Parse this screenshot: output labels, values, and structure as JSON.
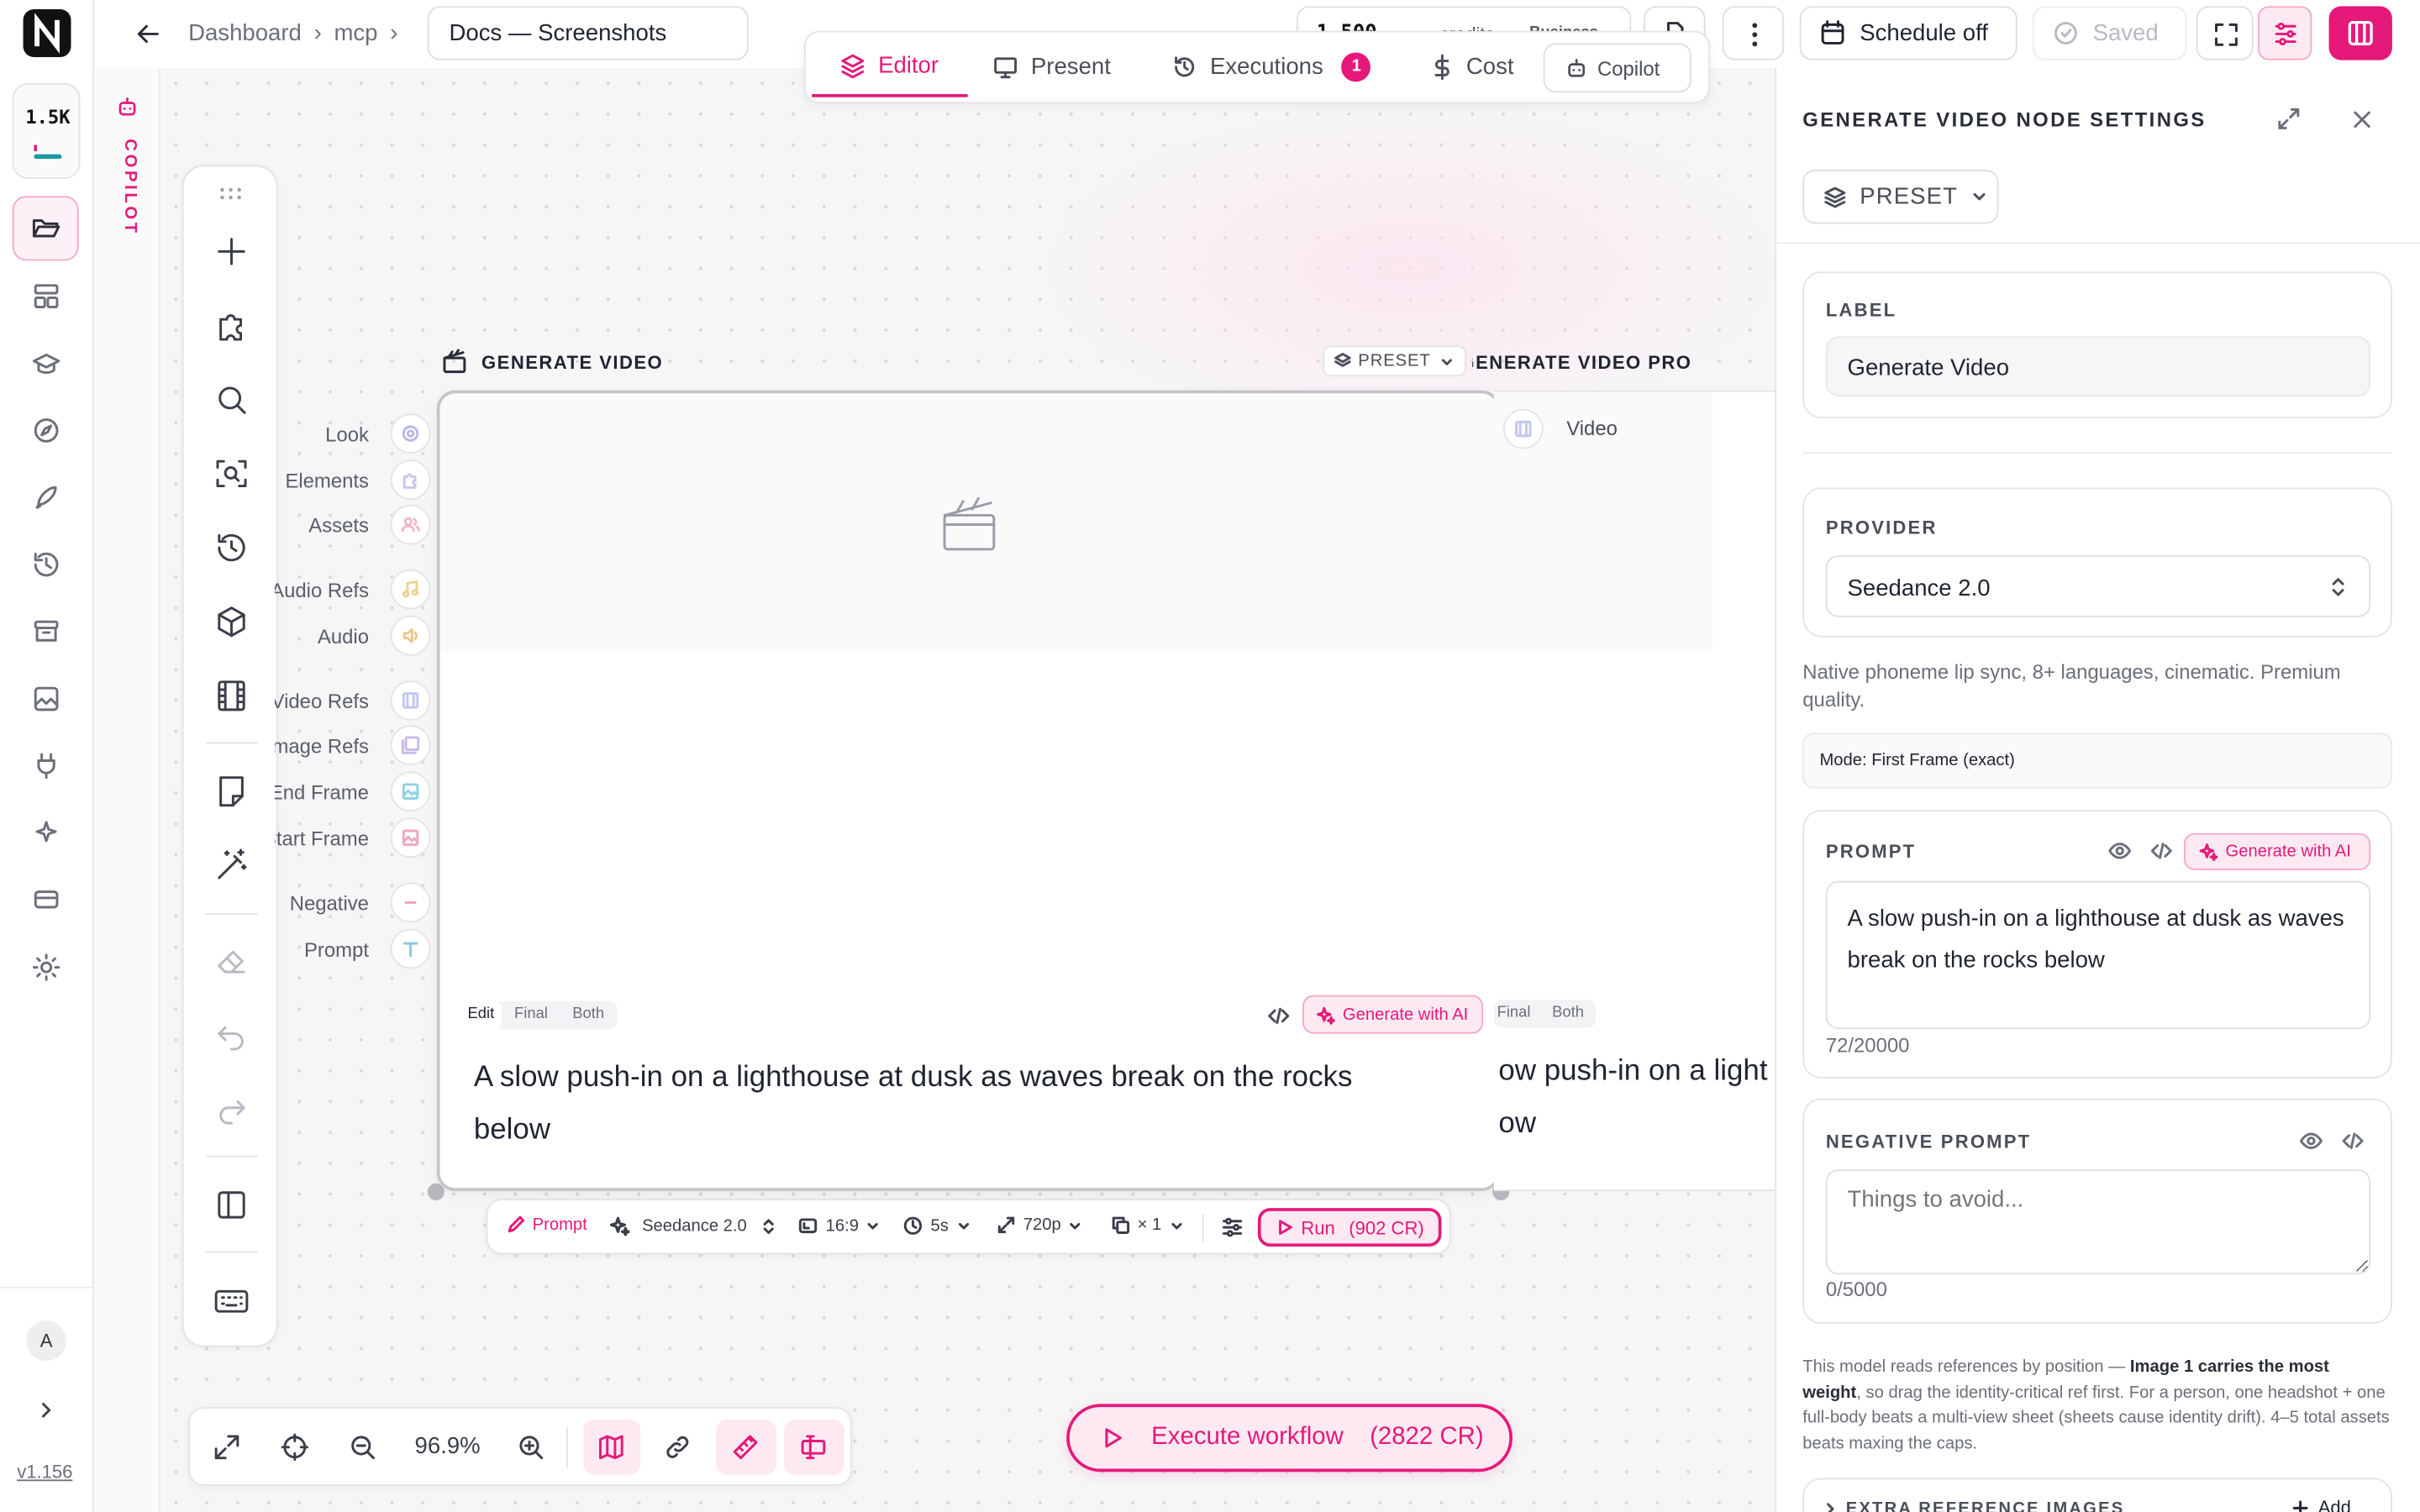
{
  "breadcrumb": {
    "items": [
      "Dashboard",
      "mcp"
    ],
    "doc_title": "Docs — Screenshots"
  },
  "credits": {
    "amount": "1,500",
    "unit": "credits",
    "plan": "Business"
  },
  "header": {
    "schedule_label": "Schedule off",
    "saved_label": "Saved"
  },
  "tabs": [
    {
      "label": "Editor"
    },
    {
      "label": "Present"
    },
    {
      "label": "Executions",
      "badge": "1"
    },
    {
      "label": "Cost"
    },
    {
      "label": "Copilot"
    }
  ],
  "sidebar": {
    "usage": "1.5K",
    "avatar": "A",
    "version": "v1.156",
    "copilot_label": "COPILOT"
  },
  "node": {
    "title": "GENERATE VIDEO",
    "ports": [
      "Look",
      "Elements",
      "Assets",
      "Audio Refs",
      "Audio",
      "Video Refs",
      "Image Refs",
      "End Frame",
      "Start Frame",
      "Negative",
      "Prompt"
    ],
    "view_modes": [
      "Edit",
      "Final",
      "Both"
    ],
    "gen_ai": "Generate with AI",
    "prompt": "A slow push-in on a lighthouse at dusk as waves break on the rocks below"
  },
  "node2": {
    "preset": "PRESET",
    "title": "GENERATE VIDEO PRO",
    "port": "Video",
    "view_modes": [
      "Final",
      "Both"
    ],
    "prompt_fragment": "ow push-in on a light",
    "prompt_fragment2": "ow"
  },
  "node_toolbar": {
    "prompt": "Prompt",
    "provider": "Seedance 2.0",
    "aspect": "16:9",
    "duration": "5s",
    "resolution": "720p",
    "count": "× 1",
    "run": "Run",
    "run_cost": "(902 CR)"
  },
  "bottom": {
    "zoom": "96.9%",
    "execute": "Execute workflow",
    "execute_cost": "(2822 CR)"
  },
  "panel": {
    "title": "GENERATE VIDEO NODE SETTINGS",
    "preset": "PRESET",
    "label_caption": "LABEL",
    "label_value": "Generate Video",
    "provider_caption": "PROVIDER",
    "provider_value": "Seedance 2.0",
    "provider_desc": "Native phoneme lip sync, 8+ languages, cinematic. Premium quality.",
    "mode": "Mode: First Frame (exact)",
    "prompt_caption": "PROMPT",
    "gen_ai": "Generate with AI",
    "prompt_value": "A slow push-in on a lighthouse at dusk as waves break on the rocks below",
    "prompt_count": "72/20000",
    "neg_caption": "NEGATIVE PROMPT",
    "neg_placeholder": "Things to avoid...",
    "neg_count": "0/5000",
    "note_a": "This model reads references by position — ",
    "note_b": "Image 1 carries the most weight",
    "note_c": ", so drag the identity-critical ref first. For a person, one headshot + one full-body beats a multi-view sheet (sheets cause identity drift). 4–5 total assets beats maxing the caps.",
    "extra_caption": "EXTRA REFERENCE IMAGES",
    "extra_add": "Add"
  },
  "colors": {
    "accent": "#e5197a",
    "accent_bg": "#fde9f2"
  }
}
